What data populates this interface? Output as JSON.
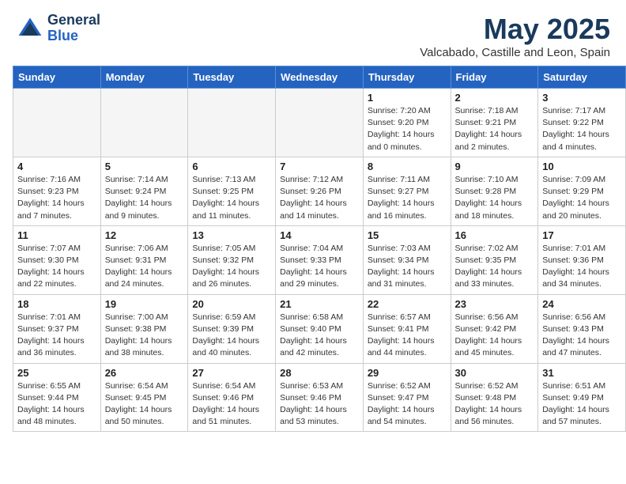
{
  "header": {
    "logo_general": "General",
    "logo_blue": "Blue",
    "month_title": "May 2025",
    "location": "Valcabado, Castille and Leon, Spain"
  },
  "weekdays": [
    "Sunday",
    "Monday",
    "Tuesday",
    "Wednesday",
    "Thursday",
    "Friday",
    "Saturday"
  ],
  "weeks": [
    [
      {
        "day": "",
        "info": ""
      },
      {
        "day": "",
        "info": ""
      },
      {
        "day": "",
        "info": ""
      },
      {
        "day": "",
        "info": ""
      },
      {
        "day": "1",
        "info": "Sunrise: 7:20 AM\nSunset: 9:20 PM\nDaylight: 14 hours\nand 0 minutes."
      },
      {
        "day": "2",
        "info": "Sunrise: 7:18 AM\nSunset: 9:21 PM\nDaylight: 14 hours\nand 2 minutes."
      },
      {
        "day": "3",
        "info": "Sunrise: 7:17 AM\nSunset: 9:22 PM\nDaylight: 14 hours\nand 4 minutes."
      }
    ],
    [
      {
        "day": "4",
        "info": "Sunrise: 7:16 AM\nSunset: 9:23 PM\nDaylight: 14 hours\nand 7 minutes."
      },
      {
        "day": "5",
        "info": "Sunrise: 7:14 AM\nSunset: 9:24 PM\nDaylight: 14 hours\nand 9 minutes."
      },
      {
        "day": "6",
        "info": "Sunrise: 7:13 AM\nSunset: 9:25 PM\nDaylight: 14 hours\nand 11 minutes."
      },
      {
        "day": "7",
        "info": "Sunrise: 7:12 AM\nSunset: 9:26 PM\nDaylight: 14 hours\nand 14 minutes."
      },
      {
        "day": "8",
        "info": "Sunrise: 7:11 AM\nSunset: 9:27 PM\nDaylight: 14 hours\nand 16 minutes."
      },
      {
        "day": "9",
        "info": "Sunrise: 7:10 AM\nSunset: 9:28 PM\nDaylight: 14 hours\nand 18 minutes."
      },
      {
        "day": "10",
        "info": "Sunrise: 7:09 AM\nSunset: 9:29 PM\nDaylight: 14 hours\nand 20 minutes."
      }
    ],
    [
      {
        "day": "11",
        "info": "Sunrise: 7:07 AM\nSunset: 9:30 PM\nDaylight: 14 hours\nand 22 minutes."
      },
      {
        "day": "12",
        "info": "Sunrise: 7:06 AM\nSunset: 9:31 PM\nDaylight: 14 hours\nand 24 minutes."
      },
      {
        "day": "13",
        "info": "Sunrise: 7:05 AM\nSunset: 9:32 PM\nDaylight: 14 hours\nand 26 minutes."
      },
      {
        "day": "14",
        "info": "Sunrise: 7:04 AM\nSunset: 9:33 PM\nDaylight: 14 hours\nand 29 minutes."
      },
      {
        "day": "15",
        "info": "Sunrise: 7:03 AM\nSunset: 9:34 PM\nDaylight: 14 hours\nand 31 minutes."
      },
      {
        "day": "16",
        "info": "Sunrise: 7:02 AM\nSunset: 9:35 PM\nDaylight: 14 hours\nand 33 minutes."
      },
      {
        "day": "17",
        "info": "Sunrise: 7:01 AM\nSunset: 9:36 PM\nDaylight: 14 hours\nand 34 minutes."
      }
    ],
    [
      {
        "day": "18",
        "info": "Sunrise: 7:01 AM\nSunset: 9:37 PM\nDaylight: 14 hours\nand 36 minutes."
      },
      {
        "day": "19",
        "info": "Sunrise: 7:00 AM\nSunset: 9:38 PM\nDaylight: 14 hours\nand 38 minutes."
      },
      {
        "day": "20",
        "info": "Sunrise: 6:59 AM\nSunset: 9:39 PM\nDaylight: 14 hours\nand 40 minutes."
      },
      {
        "day": "21",
        "info": "Sunrise: 6:58 AM\nSunset: 9:40 PM\nDaylight: 14 hours\nand 42 minutes."
      },
      {
        "day": "22",
        "info": "Sunrise: 6:57 AM\nSunset: 9:41 PM\nDaylight: 14 hours\nand 44 minutes."
      },
      {
        "day": "23",
        "info": "Sunrise: 6:56 AM\nSunset: 9:42 PM\nDaylight: 14 hours\nand 45 minutes."
      },
      {
        "day": "24",
        "info": "Sunrise: 6:56 AM\nSunset: 9:43 PM\nDaylight: 14 hours\nand 47 minutes."
      }
    ],
    [
      {
        "day": "25",
        "info": "Sunrise: 6:55 AM\nSunset: 9:44 PM\nDaylight: 14 hours\nand 48 minutes."
      },
      {
        "day": "26",
        "info": "Sunrise: 6:54 AM\nSunset: 9:45 PM\nDaylight: 14 hours\nand 50 minutes."
      },
      {
        "day": "27",
        "info": "Sunrise: 6:54 AM\nSunset: 9:46 PM\nDaylight: 14 hours\nand 51 minutes."
      },
      {
        "day": "28",
        "info": "Sunrise: 6:53 AM\nSunset: 9:46 PM\nDaylight: 14 hours\nand 53 minutes."
      },
      {
        "day": "29",
        "info": "Sunrise: 6:52 AM\nSunset: 9:47 PM\nDaylight: 14 hours\nand 54 minutes."
      },
      {
        "day": "30",
        "info": "Sunrise: 6:52 AM\nSunset: 9:48 PM\nDaylight: 14 hours\nand 56 minutes."
      },
      {
        "day": "31",
        "info": "Sunrise: 6:51 AM\nSunset: 9:49 PM\nDaylight: 14 hours\nand 57 minutes."
      }
    ]
  ]
}
